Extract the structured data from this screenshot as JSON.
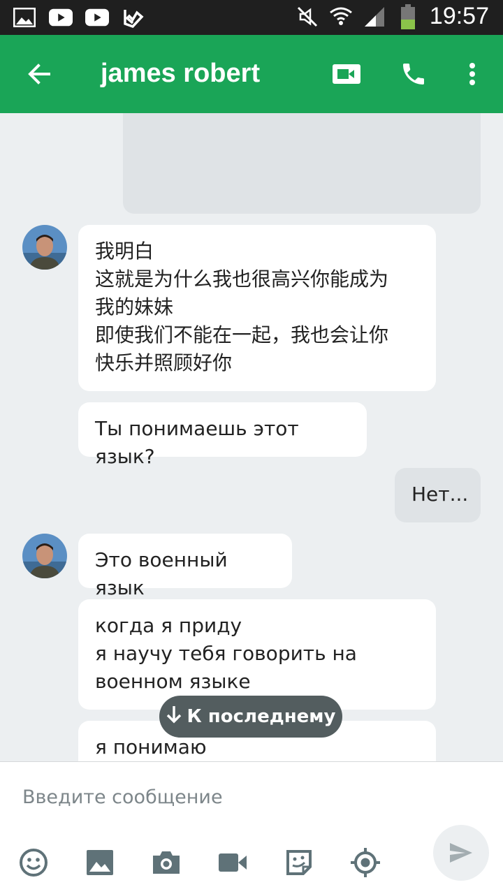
{
  "status": {
    "time": "19:57"
  },
  "header": {
    "title": "james robert"
  },
  "messages": [
    {
      "side": "in",
      "text": "我明白\n这就是为什么我也很高兴你能成为\n我的妹妹\n即使我们不能在一起，我也会让你\n快乐并照顾好你"
    },
    {
      "side": "in",
      "text": "Ты понимаешь этот язык?"
    },
    {
      "side": "out",
      "text": "Нет..."
    },
    {
      "side": "in",
      "text": "Это военный язык"
    },
    {
      "side": "in",
      "text": "когда я приду\nя научу тебя говорить на\nвоенном языке"
    },
    {
      "side": "in",
      "text": "я понимаю"
    }
  ],
  "jump_button": {
    "label": "К последнему"
  },
  "composer": {
    "placeholder": "Введите сообщение"
  },
  "colors": {
    "accent": "#1aa557",
    "background": "#eceff1",
    "status_bar": "#1f1f1f"
  },
  "icons": [
    "back-arrow-icon",
    "video-call-icon",
    "phone-icon",
    "more-vert-icon",
    "emoji-icon",
    "image-icon",
    "camera-icon",
    "video-icon",
    "sticker-icon",
    "location-icon",
    "send-icon"
  ]
}
